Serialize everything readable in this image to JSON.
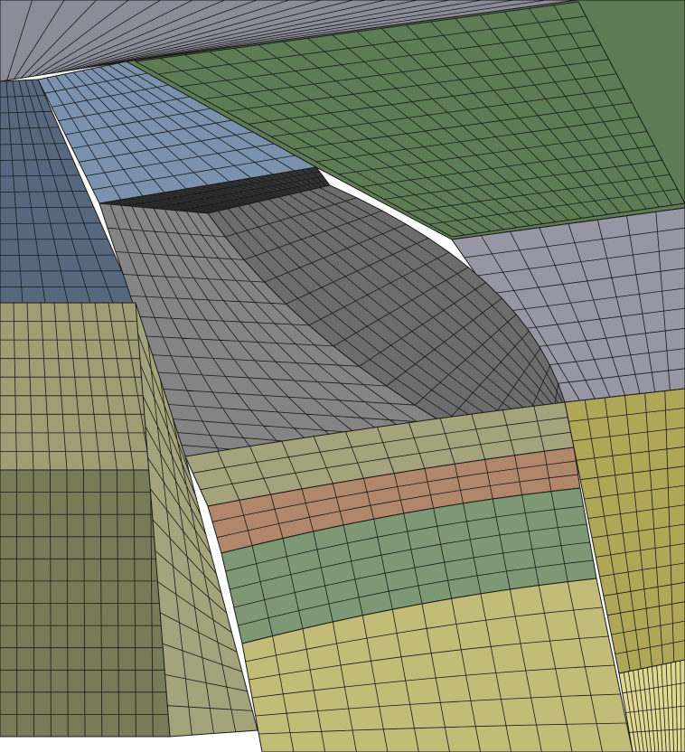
{
  "scene": {
    "kind": "fe-mesh-render",
    "background": "#ffffff",
    "edge_color": "#1a1a1a",
    "colors": {
      "top_wall": "#8c8c98",
      "blue_dark": "#56687e",
      "blue_light": "#7a92ad",
      "green_top": "#5e7c54",
      "grey_right": "#9696a4",
      "fillet_grey": "#848484",
      "fillet_dark": "#6c6c6c",
      "olive_left": "#a09d74",
      "olive_left_dark": "#797a57",
      "olive_band": "#a5a37c",
      "salmon": "#b0876a",
      "salmon_light": "#c89a84",
      "green_band": "#7e9876",
      "yellow_bottom": "#c2bc78",
      "olive_right": "#b0a658",
      "yellow_corner": "#e0d890",
      "black_seam": "#333333"
    }
  }
}
